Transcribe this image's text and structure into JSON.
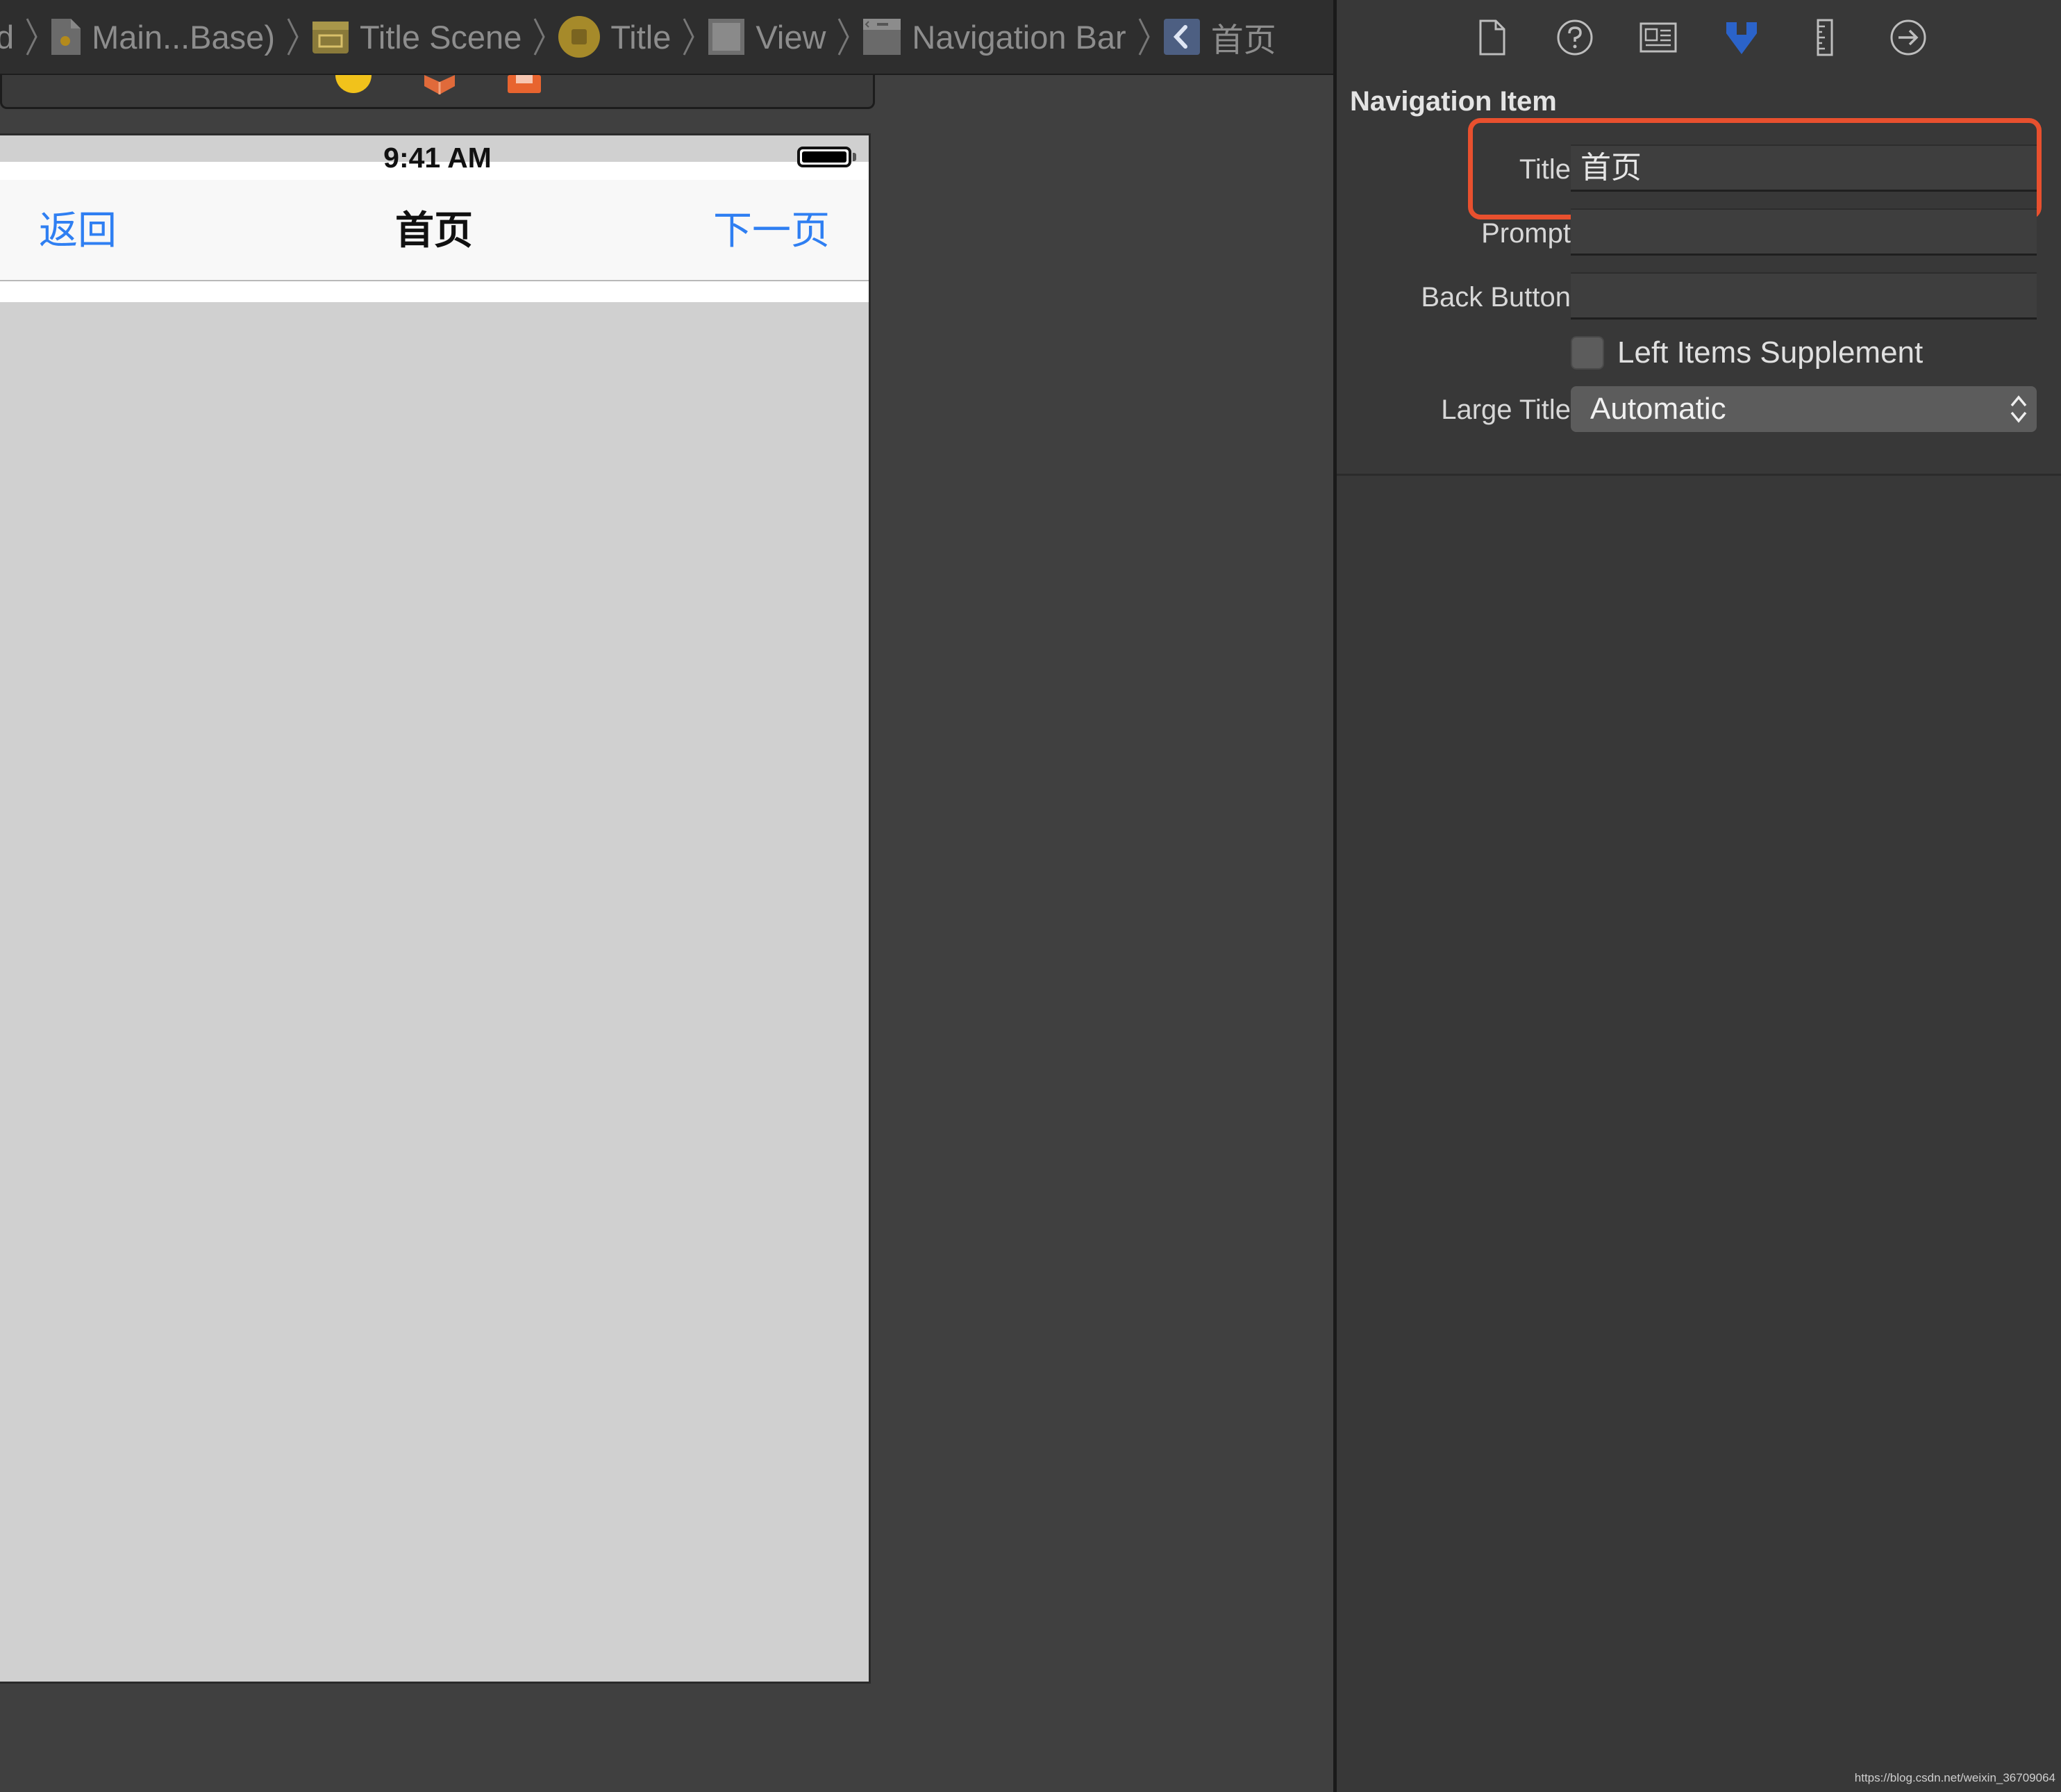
{
  "jumpbar": {
    "items": [
      {
        "label": "d",
        "icon": "none"
      },
      {
        "label": "Main...Base)",
        "icon": "storyboard-file-icon"
      },
      {
        "label": "Title Scene",
        "icon": "scene-icon"
      },
      {
        "label": "Title",
        "icon": "view-controller-icon"
      },
      {
        "label": "View",
        "icon": "view-icon"
      },
      {
        "label": "Navigation Bar",
        "icon": "navigation-bar-icon"
      },
      {
        "label": "首页",
        "icon": "navigation-item-icon"
      }
    ]
  },
  "device": {
    "status_time": "9:41 AM",
    "nav_left": "返回",
    "nav_title": "首页",
    "nav_right": "下一页"
  },
  "inspector": {
    "tabs": [
      "file-inspector-icon",
      "help-inspector-icon",
      "identity-inspector-icon",
      "attributes-inspector-icon",
      "size-inspector-icon",
      "connections-inspector-icon"
    ],
    "active_tab": "attributes-inspector-icon",
    "section_title": "Navigation Item",
    "title_label": "Title",
    "title_value": "首页",
    "prompt_label": "Prompt",
    "prompt_value": "",
    "back_button_label": "Back Button",
    "back_button_value": "",
    "left_items_supplement_label": "Left Items Supplement",
    "left_items_supplement_checked": false,
    "large_title_label": "Large Title",
    "large_title_value": "Automatic"
  },
  "colors": {
    "accent": "#2f7ff2",
    "highlight": "#e8502e",
    "active_tab": "#2b63c9"
  },
  "watermark": "https://blog.csdn.net/weixin_36709064"
}
